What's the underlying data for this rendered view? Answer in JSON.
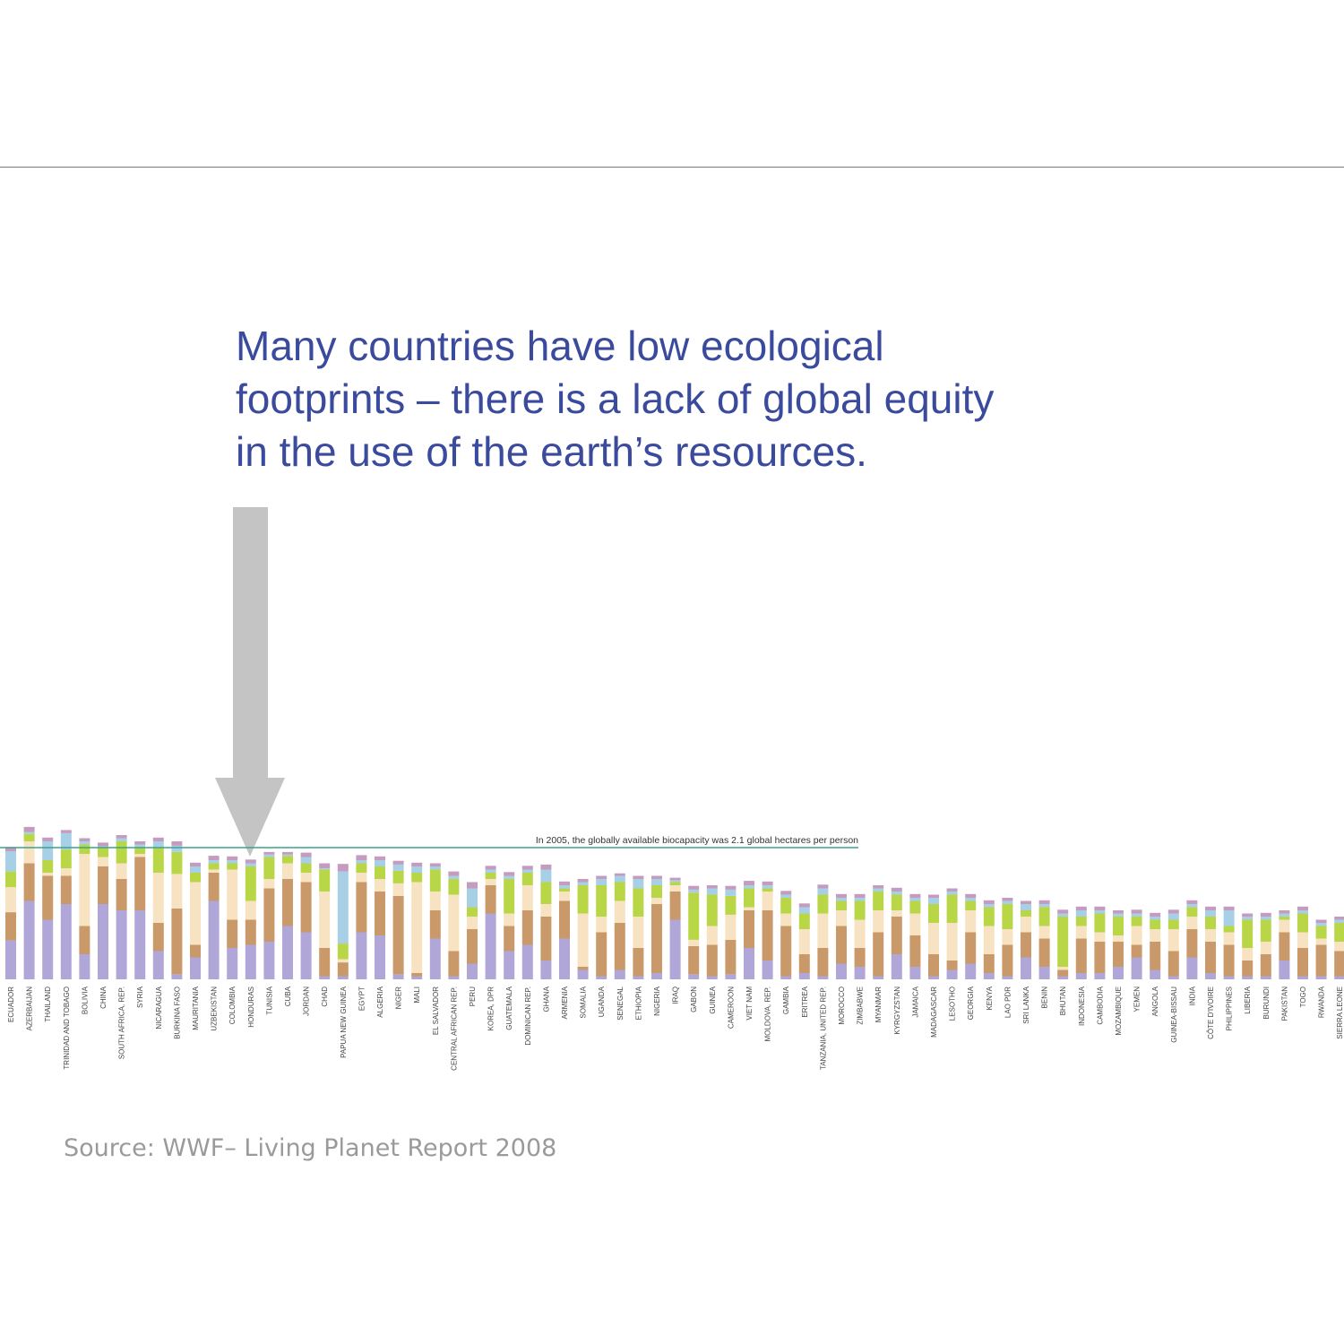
{
  "headline": {
    "line1": "Many countries have low ecological",
    "line2": "footprints – there is a lack of global equity",
    "line3": "in the use of the earth’s resources."
  },
  "source": "Source: WWF– Living Planet Report 2008",
  "colors": {
    "headline": "#3a4a9c",
    "reference_line": "#3aa38a",
    "arrow": "#c4c4c4",
    "segments": [
      "#b0a6d8",
      "#c9996a",
      "#f7e3c2",
      "#b8d646",
      "#a7d0e6",
      "#c59bbf"
    ]
  },
  "chart_data": {
    "type": "bar",
    "stacked": true,
    "reference_line": {
      "value": 2.1,
      "label": "In 2005, the globally available biocapacity was 2.1 global hectares per person"
    },
    "ylim": [
      0,
      2.5
    ],
    "categories": [
      "ECUADOR",
      "AZERBAIJAN",
      "THAILAND",
      "TRINIDAD AND TOBAGO",
      "BOLIVIA",
      "CHINA",
      "SOUTH AFRICA, REP.",
      "SYRIA",
      "NICARAGUA",
      "BURKINA FASO",
      "MAURITANIA",
      "UZBEKISTAN",
      "COLOMBIA",
      "HONDURAS",
      "TUNISIA",
      "CUBA",
      "JORDAN",
      "CHAD",
      "PAPUA NEW GUINEA",
      "EGYPT",
      "ALGERIA",
      "NIGER",
      "MALI",
      "EL SALVADOR",
      "CENTRAL AFRICAN REP.",
      "PERU",
      "KOREA, DPR",
      "GUATEMALA",
      "DOMINICAN REP.",
      "GHANA",
      "ARMENIA",
      "SOMALIA",
      "UGANDA",
      "SENEGAL",
      "ETHIOPIA",
      "NIGERIA",
      "IRAQ",
      "GABON",
      "GUINEA",
      "CAMEROON",
      "VIET NAM",
      "MOLDOVA, REP.",
      "GAMBIA",
      "ERITREA",
      "TANZANIA, UNITED REP.",
      "MOROCCO",
      "ZIMBABWE",
      "MYANMAR",
      "KYRGYZSTAN",
      "JAMAICA",
      "MADAGASCAR",
      "LESOTHO",
      "GEORGIA",
      "KENYA",
      "LAO PDR",
      "SRI LANKA",
      "BENIN",
      "BHUTAN",
      "INDONESIA",
      "CAMBODIA",
      "MOZAMBIQUE",
      "YEMEN",
      "ANGOLA",
      "GUINEA-BISSAU",
      "INDIA",
      "CÔTE D'IVOIRE",
      "PHILIPPINES",
      "LIBERIA",
      "BURUNDI",
      "PAKISTAN",
      "TOGO",
      "RWANDA",
      "SIERRA LEONE"
    ],
    "series": [],
    "values": [
      [
        0.62,
        0.45,
        0.4,
        0.25,
        0.32,
        0.07
      ],
      [
        1.25,
        0.6,
        0.35,
        0.12,
        0.03,
        0.08
      ],
      [
        0.95,
        0.7,
        0.05,
        0.2,
        0.3,
        0.06
      ],
      [
        1.2,
        0.45,
        0.12,
        0.3,
        0.26,
        0.05
      ],
      [
        0.4,
        0.45,
        1.15,
        0.15,
        0.05,
        0.05
      ],
      [
        1.2,
        0.6,
        0.15,
        0.15,
        0.02,
        0.06
      ],
      [
        1.1,
        0.5,
        0.25,
        0.35,
        0.05,
        0.05
      ],
      [
        1.1,
        0.85,
        0.05,
        0.1,
        0.05,
        0.05
      ],
      [
        0.45,
        0.45,
        0.8,
        0.4,
        0.1,
        0.06
      ],
      [
        0.08,
        1.05,
        0.55,
        0.35,
        0.1,
        0.07
      ],
      [
        0.35,
        0.2,
        1.0,
        0.15,
        0.1,
        0.06
      ],
      [
        1.25,
        0.45,
        0.05,
        0.1,
        0.05,
        0.07
      ],
      [
        0.5,
        0.45,
        0.8,
        0.1,
        0.05,
        0.06
      ],
      [
        0.55,
        0.4,
        0.3,
        0.55,
        0.05,
        0.06
      ],
      [
        0.6,
        0.85,
        0.15,
        0.35,
        0.04,
        0.04
      ],
      [
        0.85,
        0.75,
        0.25,
        0.12,
        0.02,
        0.04
      ],
      [
        0.75,
        0.8,
        0.15,
        0.15,
        0.1,
        0.07
      ],
      [
        0.05,
        0.45,
        0.9,
        0.35,
        0.02,
        0.08
      ],
      [
        0.05,
        0.22,
        0.05,
        0.25,
        1.15,
        0.12
      ],
      [
        0.75,
        0.8,
        0.15,
        0.15,
        0.05,
        0.08
      ],
      [
        0.7,
        0.7,
        0.2,
        0.2,
        0.1,
        0.06
      ],
      [
        0.08,
        1.25,
        0.2,
        0.2,
        0.1,
        0.06
      ],
      [
        0.05,
        0.05,
        1.45,
        0.15,
        0.1,
        0.06
      ],
      [
        0.65,
        0.45,
        0.3,
        0.35,
        0.05,
        0.05
      ],
      [
        0.05,
        0.4,
        0.9,
        0.25,
        0.05,
        0.07
      ],
      [
        0.25,
        0.55,
        0.2,
        0.15,
        0.3,
        0.1
      ],
      [
        1.05,
        0.45,
        0.1,
        0.1,
        0.05,
        0.06
      ],
      [
        0.45,
        0.4,
        0.2,
        0.55,
        0.05,
        0.06
      ],
      [
        0.55,
        0.55,
        0.4,
        0.2,
        0.05,
        0.06
      ],
      [
        0.3,
        0.7,
        0.2,
        0.35,
        0.2,
        0.08
      ],
      [
        0.65,
        0.6,
        0.15,
        0.05,
        0.05,
        0.06
      ],
      [
        0.15,
        0.05,
        0.85,
        0.45,
        0.05,
        0.05
      ],
      [
        0.05,
        0.7,
        0.25,
        0.5,
        0.1,
        0.05
      ],
      [
        0.15,
        0.75,
        0.35,
        0.3,
        0.1,
        0.04
      ],
      [
        0.05,
        0.45,
        0.5,
        0.45,
        0.15,
        0.05
      ],
      [
        0.1,
        1.1,
        0.1,
        0.2,
        0.1,
        0.05
      ],
      [
        0.95,
        0.45,
        0.1,
        0.05,
        0.03,
        0.04
      ],
      [
        0.08,
        0.45,
        0.1,
        0.75,
        0.05,
        0.06
      ],
      [
        0.05,
        0.5,
        0.3,
        0.5,
        0.1,
        0.05
      ],
      [
        0.08,
        0.55,
        0.4,
        0.3,
        0.1,
        0.06
      ],
      [
        0.5,
        0.6,
        0.05,
        0.3,
        0.05,
        0.07
      ],
      [
        0.3,
        0.8,
        0.3,
        0.05,
        0.05,
        0.06
      ],
      [
        0.05,
        0.8,
        0.2,
        0.25,
        0.05,
        0.06
      ],
      [
        0.1,
        0.3,
        0.4,
        0.25,
        0.1,
        0.06
      ],
      [
        0.05,
        0.45,
        0.55,
        0.3,
        0.1,
        0.06
      ],
      [
        0.25,
        0.6,
        0.25,
        0.15,
        0.05,
        0.06
      ],
      [
        0.2,
        0.3,
        0.45,
        0.3,
        0.05,
        0.06
      ],
      [
        0.05,
        0.7,
        0.35,
        0.3,
        0.05,
        0.05
      ],
      [
        0.4,
        0.6,
        0.1,
        0.25,
        0.05,
        0.06
      ],
      [
        0.2,
        0.5,
        0.35,
        0.2,
        0.05,
        0.06
      ],
      [
        0.05,
        0.35,
        0.5,
        0.3,
        0.1,
        0.05
      ],
      [
        0.15,
        0.15,
        0.6,
        0.45,
        0.05,
        0.05
      ],
      [
        0.25,
        0.5,
        0.35,
        0.15,
        0.05,
        0.06
      ],
      [
        0.1,
        0.3,
        0.45,
        0.3,
        0.05,
        0.06
      ],
      [
        0.05,
        0.5,
        0.25,
        0.4,
        0.05,
        0.05
      ],
      [
        0.35,
        0.4,
        0.25,
        0.1,
        0.1,
        0.05
      ],
      [
        0.2,
        0.45,
        0.2,
        0.3,
        0.05,
        0.06
      ],
      [
        0.05,
        0.1,
        0.05,
        0.8,
        0.05,
        0.06
      ],
      [
        0.1,
        0.55,
        0.2,
        0.15,
        0.1,
        0.06
      ],
      [
        0.1,
        0.5,
        0.15,
        0.3,
        0.05,
        0.06
      ],
      [
        0.2,
        0.4,
        0.1,
        0.3,
        0.05,
        0.05
      ],
      [
        0.35,
        0.2,
        0.3,
        0.15,
        0.05,
        0.06
      ],
      [
        0.15,
        0.45,
        0.2,
        0.15,
        0.05,
        0.06
      ],
      [
        0.05,
        0.4,
        0.35,
        0.15,
        0.1,
        0.06
      ],
      [
        0.35,
        0.45,
        0.2,
        0.15,
        0.05,
        0.06
      ],
      [
        0.1,
        0.5,
        0.2,
        0.2,
        0.1,
        0.06
      ],
      [
        0.05,
        0.5,
        0.2,
        0.1,
        0.25,
        0.06
      ],
      [
        0.05,
        0.25,
        0.2,
        0.45,
        0.05,
        0.05
      ],
      [
        0.05,
        0.35,
        0.2,
        0.35,
        0.05,
        0.06
      ],
      [
        0.3,
        0.45,
        0.2,
        0.05,
        0.05,
        0.05
      ],
      [
        0.05,
        0.45,
        0.25,
        0.3,
        0.05,
        0.06
      ],
      [
        0.05,
        0.5,
        0.1,
        0.2,
        0.05,
        0.05
      ],
      [
        0.05,
        0.4,
        0.15,
        0.3,
        0.05,
        0.05
      ]
    ]
  }
}
